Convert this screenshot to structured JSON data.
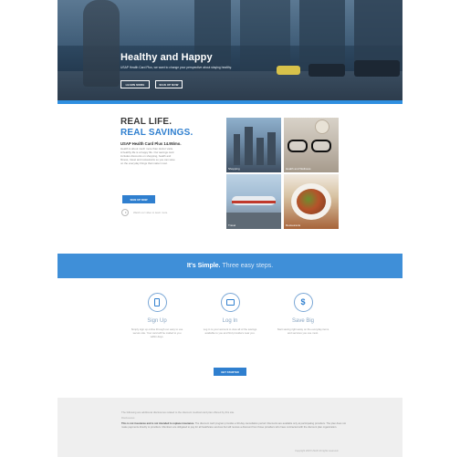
{
  "hero": {
    "title": "Healthy and Happy",
    "subtitle": "USAP Health Card Plus, we want to change your perspective about staying healthy.",
    "learn_more": "LEARN MORE",
    "sign_up": "SIGN UP NOW"
  },
  "savings": {
    "line1": "REAL LIFE.",
    "line2": "REAL SAVINGS.",
    "price": "USAP Health Card Plus 14.95/mo.",
    "description": "Health is about much more than doctor visits. A healthy life is a happy life. Our savings card includes discounts on shopping, health and fitness, travel and restaurants so you can save on the everyday things that matter most.",
    "cta": "SIGN UP NOW",
    "video_link": "Watch our video to learn more",
    "tiles": [
      {
        "label": "Shopping"
      },
      {
        "label": "Health and Wellness"
      },
      {
        "label": "Travel"
      },
      {
        "label": "Restaurants"
      }
    ]
  },
  "banner": {
    "bold": "It's Simple.",
    "light": "Three easy steps."
  },
  "steps": [
    {
      "icon": "card-icon",
      "title": "Sign Up",
      "desc": "Simply sign up online through our easy to use secure site. Your card will be mailed to you within days."
    },
    {
      "icon": "screen-icon",
      "title": "Log In",
      "desc": "Log in to your account to view all of the savings available to you and find providers near you."
    },
    {
      "icon": "dollar-icon",
      "title": "Save Big",
      "desc": "Start saving right away on the everyday items and services you use most."
    }
  ],
  "get_started": "GET STARTED",
  "footer": {
    "line1": "The following are additional disclosures related to the discount medical card plan offered by this site.",
    "line2": "Disclosures",
    "disclaimer_bold": "This is not insurance and is not intended to replace insurance.",
    "disclaimer": "The discount card program provides a 90-day cancellation period. Discounts are available only at participating providers. The plan does not make payments directly to providers. Members are obligated to pay for all healthcare services but will receive a discount from those providers who have contracted with the discount plan organization.",
    "copyright": "Copyright 2015 USAP. All rights reserved."
  }
}
